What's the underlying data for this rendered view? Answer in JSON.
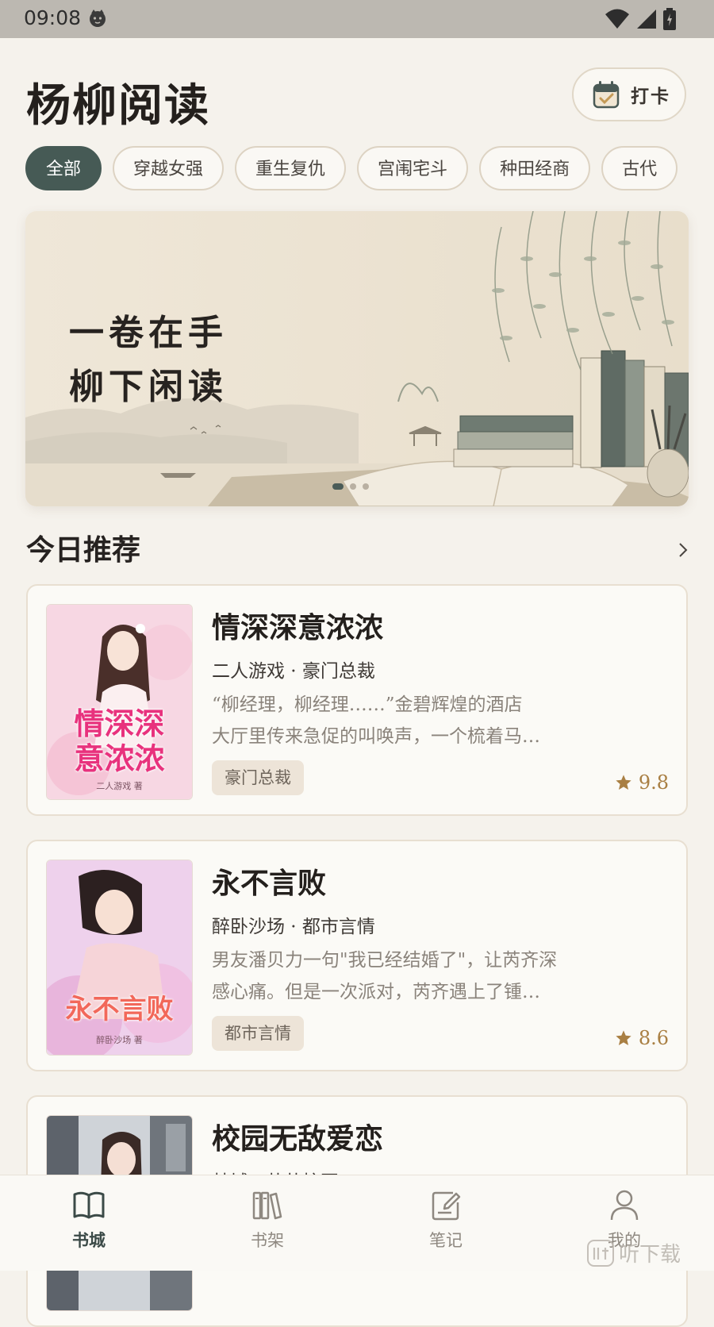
{
  "status_bar": {
    "time": "09:08"
  },
  "header": {
    "app_title": "杨柳阅读",
    "checkin_label": "打卡"
  },
  "categories": [
    {
      "label": "全部",
      "active": true
    },
    {
      "label": "穿越女强"
    },
    {
      "label": "重生复仇"
    },
    {
      "label": "宫闱宅斗"
    },
    {
      "label": "种田经商"
    },
    {
      "label": "古代"
    }
  ],
  "banner": {
    "line1": "一卷在手",
    "line2": "柳下闲读"
  },
  "section": {
    "title": "今日推荐"
  },
  "books": [
    {
      "title": "情深深意浓浓",
      "meta": "二人游戏 · 豪门总裁",
      "desc_line1": "“柳经理，柳经理……”金碧辉煌的酒店",
      "desc_line2": "大厅里传来急促的叫唤声，一个梳着马…",
      "tag": "豪门总裁",
      "rating": "9.8",
      "cover_title_line1": "情深深",
      "cover_title_line2": "意浓浓",
      "cover_author": "二人游戏 著"
    },
    {
      "title": "永不言败",
      "meta": "醉卧沙场 · 都市言情",
      "desc_line1": "男友潘贝力一句\"我已经结婚了\"，让芮齐深",
      "desc_line2": "感心痛。但是一次派对，芮齐遇上了锺…",
      "tag": "都市言情",
      "rating": "8.6",
      "cover_title_line1": "永不言败",
      "cover_author": "醉卧沙场 著"
    },
    {
      "title": "校园无敌爱恋",
      "meta": "梦城 · 萌萌校园"
    }
  ],
  "nav": [
    {
      "label": "书城",
      "icon": "open-book-icon",
      "active": true
    },
    {
      "label": "书架",
      "icon": "bookshelf-icon"
    },
    {
      "label": "笔记",
      "icon": "note-edit-icon"
    },
    {
      "label": "我的",
      "icon": "user-icon"
    }
  ],
  "watermark": "听下载",
  "colors": {
    "background": "#f5f2ec",
    "accent": "#465a55",
    "rating": "#a97f43",
    "tag_bg": "#ede4d8"
  }
}
